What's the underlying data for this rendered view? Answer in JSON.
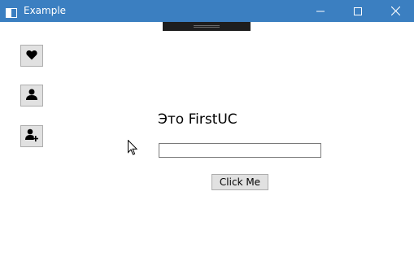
{
  "window": {
    "title": "Example",
    "icon": "window-app-icon",
    "controls": [
      "minimize-icon",
      "maximize-icon",
      "close-icon"
    ],
    "accent_color": "#3b7fc1"
  },
  "sidebar": {
    "buttons": [
      {
        "icon": "heart-icon"
      },
      {
        "icon": "user-icon"
      },
      {
        "icon": "add-user-icon"
      }
    ]
  },
  "content": {
    "label": "Это FirstUC",
    "input_value": "",
    "button_label": "Click Me"
  }
}
